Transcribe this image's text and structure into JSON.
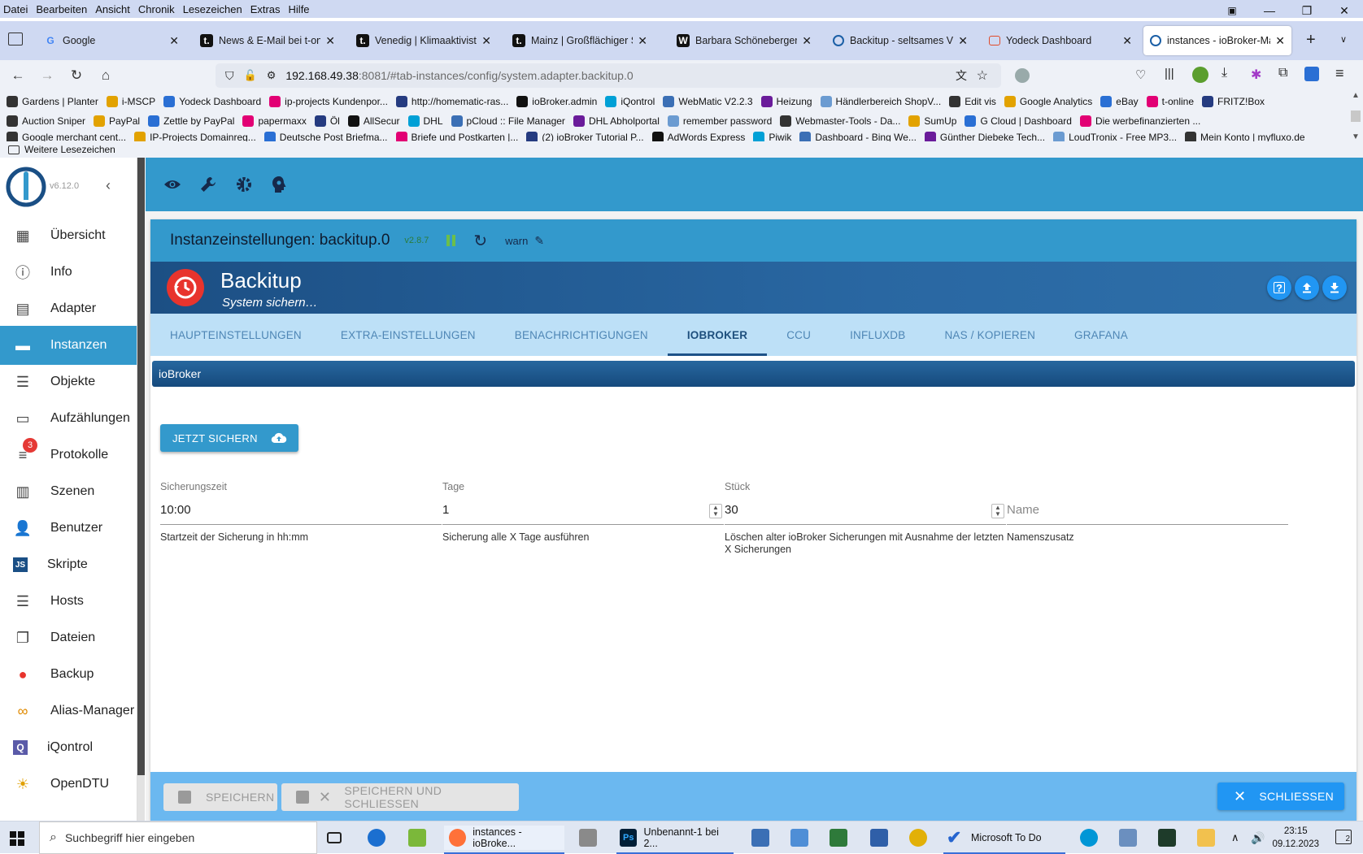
{
  "menubar": [
    "Datei",
    "Bearbeiten",
    "Ansicht",
    "Chronik",
    "Lesezeichen",
    "Extras",
    "Hilfe"
  ],
  "tabs": [
    {
      "title": "Google",
      "favicon": "G",
      "color": "#4285f4"
    },
    {
      "title": "News & E-Mail bei t-online",
      "favicon": "t.",
      "color": "#e20074"
    },
    {
      "title": "Venedig | Klimaaktivisten",
      "favicon": "t.",
      "color": "#e20074"
    },
    {
      "title": "Mainz | Großflächiger Stro",
      "favicon": "t.",
      "color": "#e20074"
    },
    {
      "title": "Barbara Schöneberger: Gü",
      "favicon": "W",
      "color": "#111111"
    },
    {
      "title": "Backitup - seltsames Verh",
      "favicon": "ioB",
      "color": "#1b5fa6"
    },
    {
      "title": "Yodeck Dashboard",
      "favicon": "Y",
      "color": "#e04b2a"
    },
    {
      "title": "instances - ioBroker-Mast",
      "favicon": "ioB",
      "color": "#1b5fa6"
    }
  ],
  "url": {
    "host": "192.168.49.38",
    "rest": ":8081/#tab-instances/config/system.adapter.backitup.0"
  },
  "bookmarks": {
    "row1": [
      "Gardens | Planter",
      "i-MSCP",
      "Yodeck Dashboard",
      "ip-projects Kundenpor...",
      "http://homematic-ras...",
      "ioBroker.admin",
      "iQontrol",
      "WebMatic V2.2.3",
      "Heizung",
      "Händlerbereich ShopV...",
      "Edit vis",
      "Google Analytics",
      "eBay",
      "t-online",
      "FRITZ!Box"
    ],
    "row2": [
      "Auction Sniper",
      "PayPal",
      "Zettle by PayPal",
      "papermaxx",
      "Öl",
      "AllSecur",
      "DHL",
      "pCloud :: File Manager",
      "DHL Abholportal",
      "remember password",
      "Webmaster-Tools - Da...",
      "SumUp",
      "G Cloud | Dashboard",
      "Die werbefinanzierten ..."
    ],
    "row3": [
      "Google merchant cent...",
      "IP-Projects Domainreg...",
      "Deutsche Post Briefma...",
      "Briefe und Postkarten |...",
      "(2) ioBroker Tutorial P...",
      "AdWords Express",
      "Piwik",
      "Dashboard - Bing We...",
      "Günther Diebeke Tech...",
      "LoudTronix - Free MP3...",
      "Mein Konto | myfluxo.de"
    ],
    "more": "Weitere Lesezeichen"
  },
  "app": {
    "version": "v6.12.0",
    "sidebar": [
      {
        "label": "Übersicht",
        "icon": "grid-icon"
      },
      {
        "label": "Info",
        "icon": "info-icon"
      },
      {
        "label": "Adapter",
        "icon": "store-icon"
      },
      {
        "label": "Instanzen",
        "icon": "instances-icon",
        "active": true
      },
      {
        "label": "Objekte",
        "icon": "list-icon"
      },
      {
        "label": "Aufzählungen",
        "icon": "enum-icon"
      },
      {
        "label": "Protokolle",
        "icon": "log-icon",
        "badge": "3"
      },
      {
        "label": "Szenen",
        "icon": "scenes-icon"
      },
      {
        "label": "Benutzer",
        "icon": "user-icon"
      },
      {
        "label": "Skripte",
        "icon": "js-icon"
      },
      {
        "label": "Hosts",
        "icon": "hosts-icon"
      },
      {
        "label": "Dateien",
        "icon": "files-icon"
      },
      {
        "label": "Backup",
        "icon": "backup-icon"
      },
      {
        "label": "Alias-Manager",
        "icon": "alias-icon"
      },
      {
        "label": "iQontrol",
        "icon": "iqontrol-icon"
      },
      {
        "label": "OpenDTU",
        "icon": "opendtu-icon"
      }
    ],
    "card_title": "Instanzeinstellungen: backitup.0",
    "card_version": "v2.8.7",
    "log_level": "warn",
    "adapter_name": "Backitup",
    "adapter_desc": "System sichern…",
    "config_tabs": [
      "HAUPTEINSTELLUNGEN",
      "EXTRA-EINSTELLUNGEN",
      "BENACHRICHTIGUNGEN",
      "IOBROKER",
      "CCU",
      "INFLUXDB",
      "NAS / KOPIEREN",
      "GRAFANA"
    ],
    "active_tab": "IOBROKER",
    "section_title": "ioBroker",
    "backup_button": "JETZT SICHERN",
    "fields": [
      {
        "label": "Sicherungszeit",
        "value": "10:00",
        "help": "Startzeit der Sicherung in hh:mm",
        "spinner": false
      },
      {
        "label": "Tage",
        "value": "1",
        "help": "Sicherung alle X Tage ausführen",
        "spinner": true
      },
      {
        "label": "Stück",
        "value": "30",
        "help": "Löschen alter ioBroker Sicherungen mit Ausnahme der letzten X Sicherungen",
        "spinner": true
      },
      {
        "label": "",
        "placeholder": "Name",
        "help": "Namenszusatz",
        "spinner": false
      }
    ],
    "footer": {
      "save": "SPEICHERN",
      "save_close": "SPEICHERN UND SCHLIESSEN",
      "close": "SCHLIESSEN"
    }
  },
  "taskbar": {
    "search_placeholder": "Suchbegriff hier eingeben",
    "apps": [
      {
        "label": "instances - ioBroke...",
        "color": "#ff7139"
      },
      {
        "label": "Unbenannt-1 bei 2...",
        "color": "#001e36"
      },
      {
        "label": "Microsoft To Do",
        "color": "#2564cf"
      }
    ],
    "time": "23:15",
    "date": "09.12.2023",
    "notifications": "2"
  }
}
